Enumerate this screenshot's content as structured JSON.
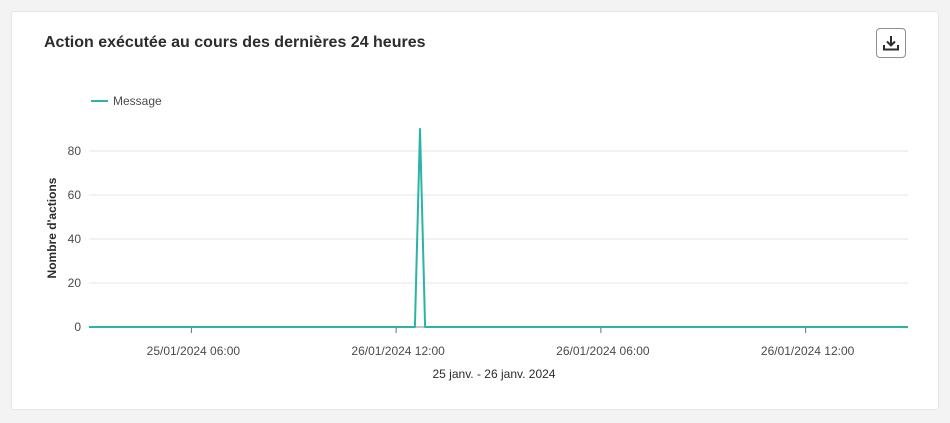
{
  "card": {
    "title": "Action exécutée au cours des dernières 24 heures",
    "download_icon": "download-icon"
  },
  "chart_data": {
    "type": "line",
    "title": "Action exécutée au cours des dernières 24 heures",
    "xlabel": "25 janv. - 26 janv. 2024",
    "ylabel": "Nombre d'actions",
    "x_ticks": [
      "25/01/2024 06:00",
      "26/01/2024 12:00",
      "26/01/2024 06:00",
      "26/01/2024 12:00"
    ],
    "y_ticks": [
      0,
      20,
      40,
      60,
      80
    ],
    "ylim": [
      0,
      90
    ],
    "grid": true,
    "legend": "top-left",
    "colors": {
      "series": "#2bb3a6",
      "grid": "#e4e4e4",
      "axis": "#555555"
    },
    "series": [
      {
        "name": "Message",
        "color": "#2bb3a6",
        "points": [
          {
            "t": 0,
            "y": 0
          },
          {
            "t": 19.1,
            "y": 0
          },
          {
            "t": 19.4,
            "y": 90
          },
          {
            "t": 19.7,
            "y": 0
          },
          {
            "t": 48,
            "y": 0
          }
        ]
      }
    ]
  }
}
